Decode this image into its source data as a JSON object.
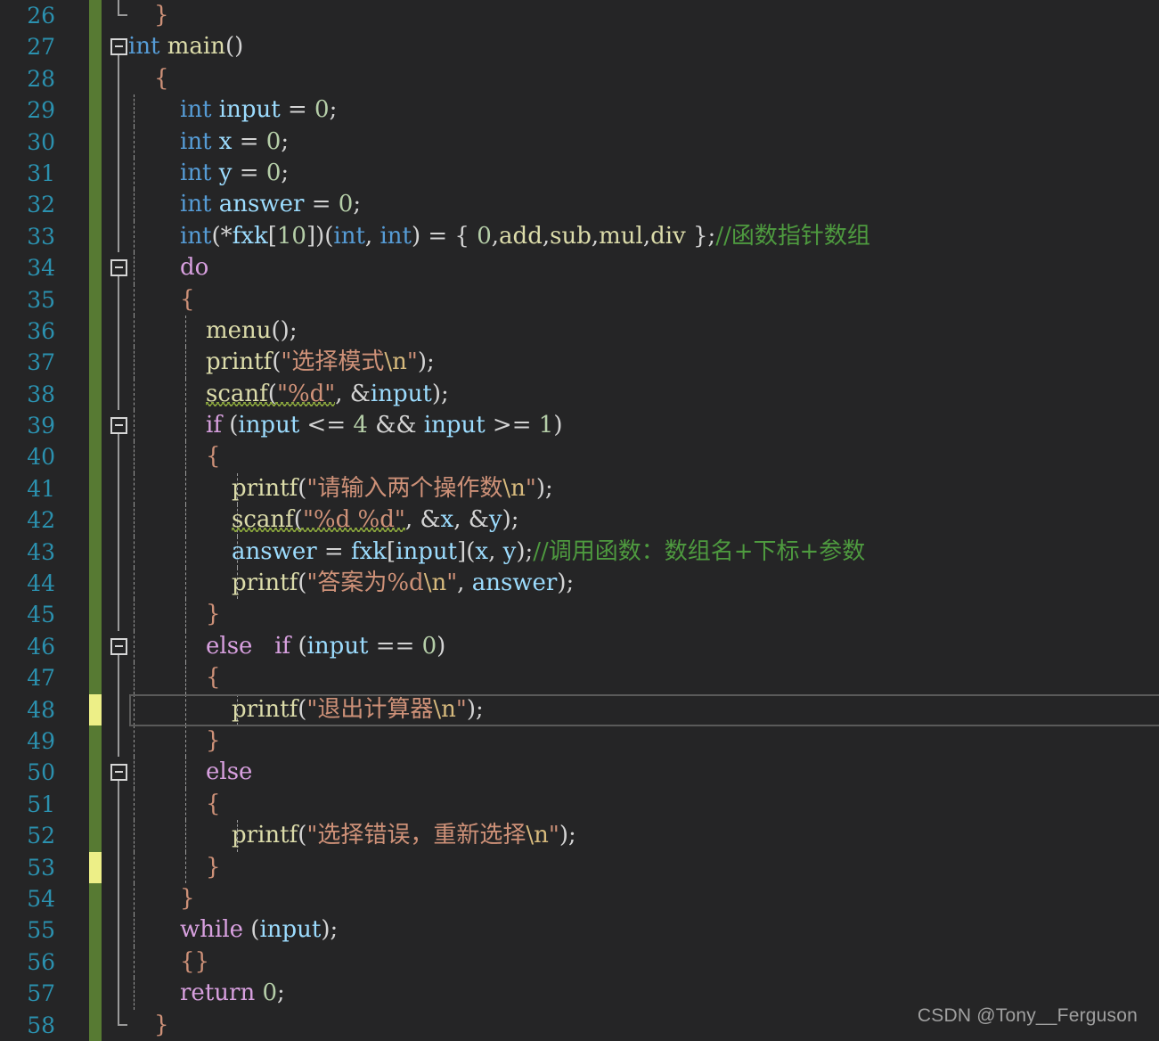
{
  "editor": {
    "first_line": 26,
    "last_line": 58,
    "language": "C",
    "colors": {
      "background": "#252526",
      "line_number": "#2B91AF",
      "keyword": "#569CD6",
      "control": "#D8A0DF",
      "identifier": "#9CDCFE",
      "function": "#DCDCAA",
      "number": "#B5CEA8",
      "string": "#CE9178",
      "comment": "#4E9A3F",
      "change_saved": "#577A33",
      "change_unsaved": "#EDEF87",
      "current_line_border": "#5A5A5A"
    },
    "current_line": 48
  },
  "lines": [
    {
      "n": "26",
      "change": "green",
      "fold": "end",
      "guides": [],
      "indent": 1,
      "tokens": [
        {
          "t": "}",
          "c": "brc"
        }
      ]
    },
    {
      "n": "27",
      "change": "green",
      "fold": "box-open",
      "guides": [],
      "indent": 0,
      "tokens": [
        {
          "t": "int",
          "c": "kw"
        },
        {
          "t": " ",
          "c": "pun"
        },
        {
          "t": "main",
          "c": "fn"
        },
        {
          "t": "()",
          "c": "pun"
        }
      ]
    },
    {
      "n": "28",
      "change": "green",
      "fold": "line",
      "guides": [],
      "indent": 1,
      "tokens": [
        {
          "t": "{",
          "c": "brc"
        }
      ]
    },
    {
      "n": "29",
      "change": "green",
      "fold": "line",
      "guides": [
        1
      ],
      "indent": 2,
      "tokens": [
        {
          "t": "int",
          "c": "kw"
        },
        {
          "t": " ",
          "c": "pun"
        },
        {
          "t": "input",
          "c": "var"
        },
        {
          "t": " = ",
          "c": "op"
        },
        {
          "t": "0",
          "c": "num"
        },
        {
          "t": ";",
          "c": "pun"
        }
      ]
    },
    {
      "n": "30",
      "change": "green",
      "fold": "line",
      "guides": [
        1
      ],
      "indent": 2,
      "tokens": [
        {
          "t": "int",
          "c": "kw"
        },
        {
          "t": " ",
          "c": "pun"
        },
        {
          "t": "x",
          "c": "var"
        },
        {
          "t": " = ",
          "c": "op"
        },
        {
          "t": "0",
          "c": "num"
        },
        {
          "t": ";",
          "c": "pun"
        }
      ]
    },
    {
      "n": "31",
      "change": "green",
      "fold": "line",
      "guides": [
        1
      ],
      "indent": 2,
      "tokens": [
        {
          "t": "int",
          "c": "kw"
        },
        {
          "t": " ",
          "c": "pun"
        },
        {
          "t": "y",
          "c": "var"
        },
        {
          "t": " = ",
          "c": "op"
        },
        {
          "t": "0",
          "c": "num"
        },
        {
          "t": ";",
          "c": "pun"
        }
      ]
    },
    {
      "n": "32",
      "change": "green",
      "fold": "line",
      "guides": [
        1
      ],
      "indent": 2,
      "tokens": [
        {
          "t": "int",
          "c": "kw"
        },
        {
          "t": " ",
          "c": "pun"
        },
        {
          "t": "answer",
          "c": "var"
        },
        {
          "t": " = ",
          "c": "op"
        },
        {
          "t": "0",
          "c": "num"
        },
        {
          "t": ";",
          "c": "pun"
        }
      ]
    },
    {
      "n": "33",
      "change": "green",
      "fold": "line",
      "guides": [
        1
      ],
      "indent": 2,
      "tokens": [
        {
          "t": "int",
          "c": "kw"
        },
        {
          "t": "(*",
          "c": "pun"
        },
        {
          "t": "fxk",
          "c": "var"
        },
        {
          "t": "[",
          "c": "pun"
        },
        {
          "t": "10",
          "c": "num"
        },
        {
          "t": "])(",
          "c": "pun"
        },
        {
          "t": "int",
          "c": "kw"
        },
        {
          "t": ", ",
          "c": "pun"
        },
        {
          "t": "int",
          "c": "kw"
        },
        {
          "t": ") = { ",
          "c": "pun"
        },
        {
          "t": "0",
          "c": "num"
        },
        {
          "t": ",",
          "c": "pun"
        },
        {
          "t": "add",
          "c": "fn"
        },
        {
          "t": ",",
          "c": "pun"
        },
        {
          "t": "sub",
          "c": "fn"
        },
        {
          "t": ",",
          "c": "pun"
        },
        {
          "t": "mul",
          "c": "fn"
        },
        {
          "t": ",",
          "c": "pun"
        },
        {
          "t": "div",
          "c": "fn"
        },
        {
          "t": " };",
          "c": "pun"
        },
        {
          "t": "//函数指针数组",
          "c": "cmt"
        }
      ]
    },
    {
      "n": "34",
      "change": "green",
      "fold": "box-open",
      "guides": [
        1
      ],
      "indent": 2,
      "tokens": [
        {
          "t": "do",
          "c": "ctl"
        }
      ]
    },
    {
      "n": "35",
      "change": "green",
      "fold": "line",
      "guides": [
        1
      ],
      "indent": 2,
      "tokens": [
        {
          "t": "{",
          "c": "brc"
        }
      ]
    },
    {
      "n": "36",
      "change": "green",
      "fold": "line",
      "guides": [
        1,
        2
      ],
      "indent": 3,
      "tokens": [
        {
          "t": "menu",
          "c": "fn"
        },
        {
          "t": "();",
          "c": "pun"
        }
      ]
    },
    {
      "n": "37",
      "change": "green",
      "fold": "line",
      "guides": [
        1,
        2
      ],
      "indent": 3,
      "tokens": [
        {
          "t": "printf",
          "c": "fn"
        },
        {
          "t": "(",
          "c": "pun"
        },
        {
          "t": "\"选择模式",
          "c": "str"
        },
        {
          "t": "\\n",
          "c": "esc"
        },
        {
          "t": "\"",
          "c": "str"
        },
        {
          "t": ");",
          "c": "pun"
        }
      ]
    },
    {
      "n": "38",
      "change": "green",
      "fold": "line",
      "guides": [
        1,
        2
      ],
      "indent": 3,
      "squiggle_to": 10,
      "tokens": [
        {
          "t": "scanf",
          "c": "fn"
        },
        {
          "t": "(",
          "c": "pun"
        },
        {
          "t": "\"%d\"",
          "c": "str"
        },
        {
          "t": ", &",
          "c": "pun"
        },
        {
          "t": "input",
          "c": "var"
        },
        {
          "t": ")",
          "c": "pun"
        },
        {
          "t": ";",
          "c": "pun"
        }
      ]
    },
    {
      "n": "39",
      "change": "green",
      "fold": "box-open",
      "guides": [
        1,
        2
      ],
      "indent": 3,
      "tokens": [
        {
          "t": "if",
          "c": "ctl"
        },
        {
          "t": " (",
          "c": "pun"
        },
        {
          "t": "input",
          "c": "var"
        },
        {
          "t": " <= ",
          "c": "op"
        },
        {
          "t": "4",
          "c": "num"
        },
        {
          "t": " && ",
          "c": "op"
        },
        {
          "t": "input",
          "c": "var"
        },
        {
          "t": " >= ",
          "c": "op"
        },
        {
          "t": "1",
          "c": "num"
        },
        {
          "t": ")",
          "c": "pun"
        }
      ]
    },
    {
      "n": "40",
      "change": "green",
      "fold": "line",
      "guides": [
        1,
        2
      ],
      "indent": 3,
      "tokens": [
        {
          "t": "{",
          "c": "brc"
        }
      ]
    },
    {
      "n": "41",
      "change": "green",
      "fold": "line",
      "guides": [
        1,
        2,
        3
      ],
      "indent": 4,
      "tokens": [
        {
          "t": "printf",
          "c": "fn"
        },
        {
          "t": "(",
          "c": "pun"
        },
        {
          "t": "\"请输入两个操作数",
          "c": "str"
        },
        {
          "t": "\\n",
          "c": "esc"
        },
        {
          "t": "\"",
          "c": "str"
        },
        {
          "t": ");",
          "c": "pun"
        }
      ]
    },
    {
      "n": "42",
      "change": "green",
      "fold": "line",
      "guides": [
        1,
        2,
        3
      ],
      "indent": 4,
      "squiggle_to": 12,
      "tokens": [
        {
          "t": "scanf",
          "c": "fn"
        },
        {
          "t": "(",
          "c": "pun"
        },
        {
          "t": "\"%d %d\"",
          "c": "str"
        },
        {
          "t": ", &",
          "c": "pun"
        },
        {
          "t": "x",
          "c": "var"
        },
        {
          "t": ", &",
          "c": "pun"
        },
        {
          "t": "y",
          "c": "var"
        },
        {
          "t": ")",
          "c": "pun"
        },
        {
          "t": ";",
          "c": "pun"
        }
      ]
    },
    {
      "n": "43",
      "change": "green",
      "fold": "line",
      "guides": [
        1,
        2,
        3
      ],
      "indent": 4,
      "tokens": [
        {
          "t": "answer",
          "c": "var"
        },
        {
          "t": " = ",
          "c": "op"
        },
        {
          "t": "fxk",
          "c": "var"
        },
        {
          "t": "[",
          "c": "pun"
        },
        {
          "t": "input",
          "c": "var"
        },
        {
          "t": "](",
          "c": "pun"
        },
        {
          "t": "x",
          "c": "var"
        },
        {
          "t": ", ",
          "c": "pun"
        },
        {
          "t": "y",
          "c": "var"
        },
        {
          "t": ");",
          "c": "pun"
        },
        {
          "t": "//调用函数：数组名+下标+参数",
          "c": "cmt"
        }
      ]
    },
    {
      "n": "44",
      "change": "green",
      "fold": "line",
      "guides": [
        1,
        2,
        3
      ],
      "indent": 4,
      "tokens": [
        {
          "t": "printf",
          "c": "fn"
        },
        {
          "t": "(",
          "c": "pun"
        },
        {
          "t": "\"答案为%d",
          "c": "str"
        },
        {
          "t": "\\n",
          "c": "esc"
        },
        {
          "t": "\"",
          "c": "str"
        },
        {
          "t": ", ",
          "c": "pun"
        },
        {
          "t": "answer",
          "c": "var"
        },
        {
          "t": ");",
          "c": "pun"
        }
      ]
    },
    {
      "n": "45",
      "change": "green",
      "fold": "line",
      "guides": [
        1,
        2
      ],
      "indent": 3,
      "tokens": [
        {
          "t": "}",
          "c": "brc"
        }
      ]
    },
    {
      "n": "46",
      "change": "green",
      "fold": "box-open",
      "guides": [
        1,
        2
      ],
      "indent": 3,
      "tokens": [
        {
          "t": "else",
          "c": "ctl"
        },
        {
          "t": "   ",
          "c": "pun"
        },
        {
          "t": "if",
          "c": "ctl"
        },
        {
          "t": " (",
          "c": "pun"
        },
        {
          "t": "input",
          "c": "var"
        },
        {
          "t": " == ",
          "c": "op"
        },
        {
          "t": "0",
          "c": "num"
        },
        {
          "t": ")",
          "c": "pun"
        }
      ]
    },
    {
      "n": "47",
      "change": "green",
      "fold": "line",
      "guides": [
        1,
        2
      ],
      "indent": 3,
      "tokens": [
        {
          "t": "{",
          "c": "brc"
        }
      ]
    },
    {
      "n": "48",
      "change": "yellow",
      "fold": "line",
      "guides": [
        1,
        2,
        3
      ],
      "indent": 4,
      "tokens": [
        {
          "t": "printf",
          "c": "fn"
        },
        {
          "t": "(",
          "c": "pun"
        },
        {
          "t": "\"退出计算器",
          "c": "str"
        },
        {
          "t": "\\n",
          "c": "esc"
        },
        {
          "t": "\"",
          "c": "str"
        },
        {
          "t": ");",
          "c": "pun"
        }
      ]
    },
    {
      "n": "49",
      "change": "green",
      "fold": "line",
      "guides": [
        1,
        2
      ],
      "indent": 3,
      "tokens": [
        {
          "t": "}",
          "c": "brc"
        }
      ]
    },
    {
      "n": "50",
      "change": "green",
      "fold": "box-open",
      "guides": [
        1,
        2
      ],
      "indent": 3,
      "tokens": [
        {
          "t": "else",
          "c": "ctl"
        }
      ]
    },
    {
      "n": "51",
      "change": "green",
      "fold": "line",
      "guides": [
        1,
        2
      ],
      "indent": 3,
      "tokens": [
        {
          "t": "{",
          "c": "brc"
        }
      ]
    },
    {
      "n": "52",
      "change": "green",
      "fold": "line",
      "guides": [
        1,
        2,
        3
      ],
      "indent": 4,
      "tokens": [
        {
          "t": "printf",
          "c": "fn"
        },
        {
          "t": "(",
          "c": "pun"
        },
        {
          "t": "\"选择错误，重新选择",
          "c": "str"
        },
        {
          "t": "\\n",
          "c": "esc"
        },
        {
          "t": "\"",
          "c": "str"
        },
        {
          "t": ");",
          "c": "pun"
        }
      ]
    },
    {
      "n": "53",
      "change": "yellow",
      "fold": "line",
      "guides": [
        1,
        2
      ],
      "indent": 3,
      "tokens": [
        {
          "t": "}",
          "c": "brc"
        }
      ]
    },
    {
      "n": "54",
      "change": "green",
      "fold": "line",
      "guides": [
        1
      ],
      "indent": 2,
      "tokens": [
        {
          "t": "}",
          "c": "brc"
        }
      ]
    },
    {
      "n": "55",
      "change": "green",
      "fold": "line",
      "guides": [
        1
      ],
      "indent": 2,
      "tokens": [
        {
          "t": "while",
          "c": "ctl"
        },
        {
          "t": " (",
          "c": "pun"
        },
        {
          "t": "input",
          "c": "var"
        },
        {
          "t": ");",
          "c": "pun"
        }
      ]
    },
    {
      "n": "56",
      "change": "green",
      "fold": "line",
      "guides": [
        1
      ],
      "indent": 2,
      "tokens": [
        {
          "t": "{}",
          "c": "brc"
        }
      ]
    },
    {
      "n": "57",
      "change": "green",
      "fold": "line",
      "guides": [
        1
      ],
      "indent": 2,
      "tokens": [
        {
          "t": "return",
          "c": "ctl"
        },
        {
          "t": " ",
          "c": "pun"
        },
        {
          "t": "0",
          "c": "num"
        },
        {
          "t": ";",
          "c": "pun"
        }
      ]
    },
    {
      "n": "58",
      "change": "green",
      "fold": "end",
      "guides": [],
      "indent": 1,
      "tokens": [
        {
          "t": "}",
          "c": "brc"
        }
      ]
    }
  ],
  "watermark": {
    "text": "CSDN @Tony__Ferguson"
  }
}
